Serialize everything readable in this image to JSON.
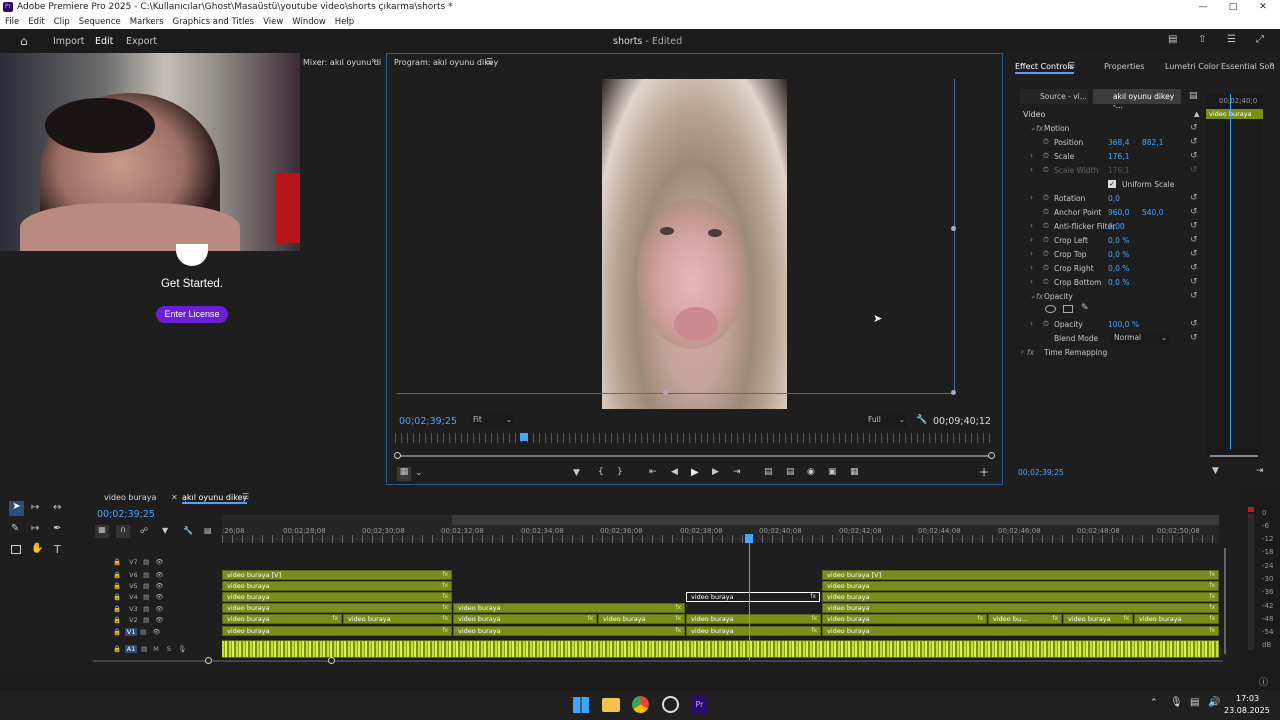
{
  "window": {
    "title": "Adobe Premiere Pro 2025 - C:\\Kullanıcılar\\Ghost\\Masaüstü\\youtube video\\shorts çıkarma\\shorts *"
  },
  "menu": [
    "File",
    "Edit",
    "Clip",
    "Sequence",
    "Markers",
    "Graphics and Titles",
    "View",
    "Window",
    "Help"
  ],
  "appbar": {
    "tabs": [
      "Import",
      "Edit",
      "Export"
    ],
    "project": "shorts",
    "status": "- Edited"
  },
  "overlay": {
    "get_started": "Get Started.",
    "license_button": "Enter License"
  },
  "mixer": {
    "label": "Mixer: akıl oyunu di"
  },
  "program": {
    "title": "Program: akıl oyunu dikey",
    "timecode": "00;02;39;25",
    "fit": "Fit",
    "quality": "Full",
    "duration": "00;09;40;12"
  },
  "effect_tabs": [
    "Effect Controls",
    "Properties",
    "Lumetri Color",
    "Essential Sou"
  ],
  "effect_controls": {
    "source": "Source - vi...",
    "sequence": "akıl oyunu dikey -...",
    "mini_time": "00;02;40;0",
    "mini_clip": "video buraya",
    "section": "Video",
    "motion": "Motion",
    "properties": [
      {
        "label": "Position",
        "v1": "368,4",
        "v2": "882,1"
      },
      {
        "label": "Scale",
        "v1": "176,1",
        "v2": ""
      },
      {
        "label": "Scale Width",
        "v1": "176,1",
        "v2": ""
      },
      {
        "label": "Uniform Scale",
        "v1": "",
        "v2": ""
      },
      {
        "label": "Rotation",
        "v1": "0,0",
        "v2": ""
      },
      {
        "label": "Anchor Point",
        "v1": "960,0",
        "v2": "540,0"
      },
      {
        "label": "Anti-flicker Filter",
        "v1": "0,00",
        "v2": ""
      },
      {
        "label": "Crop Left",
        "v1": "0,0 %",
        "v2": ""
      },
      {
        "label": "Crop Top",
        "v1": "0,0 %",
        "v2": ""
      },
      {
        "label": "Crop Right",
        "v1": "0,0 %",
        "v2": ""
      },
      {
        "label": "Crop Bottom",
        "v1": "0,0 %",
        "v2": ""
      }
    ],
    "opacity_section": "Opacity",
    "opacity_label": "Opacity",
    "opacity_value": "100,0 %",
    "blend_label": "Blend Mode",
    "blend_value": "Normal",
    "time_remap": "Time Remapping",
    "footer_time": "00;02;39;25"
  },
  "timeline": {
    "tabs": [
      "video buraya",
      "akıl oyunu dikey"
    ],
    "timecode": "00;02;39;25",
    "ruler": [
      ":26;08",
      "00;02;28;08",
      "00;02;30;08",
      "00;02;32;08",
      "00;02;34;08",
      "00;02;36;08",
      "00;02;38;08",
      "00;02;40;08",
      "00;02;42;08",
      "00;02;44;08",
      "00;02;46;08",
      "00;02;48;08",
      "00;02;50;08"
    ],
    "tracks": [
      "V7",
      "V6",
      "V5",
      "V4",
      "V3",
      "V2",
      "V1",
      "A1"
    ],
    "clip_label": "video buraya",
    "clip_label_v": "video buraya [V]",
    "clip_label_short": "video bu...",
    "meter": [
      "0",
      "-6",
      "-12",
      "-18",
      "-24",
      "-30",
      "-36",
      "-42",
      "-48",
      "-54",
      "dB"
    ]
  },
  "taskbar": {
    "time": "17:03",
    "date": "23.08.2025"
  },
  "colors": {
    "clip": "#7a8f1b",
    "accent": "#4aa3ff",
    "license": "#6b1fd6"
  }
}
